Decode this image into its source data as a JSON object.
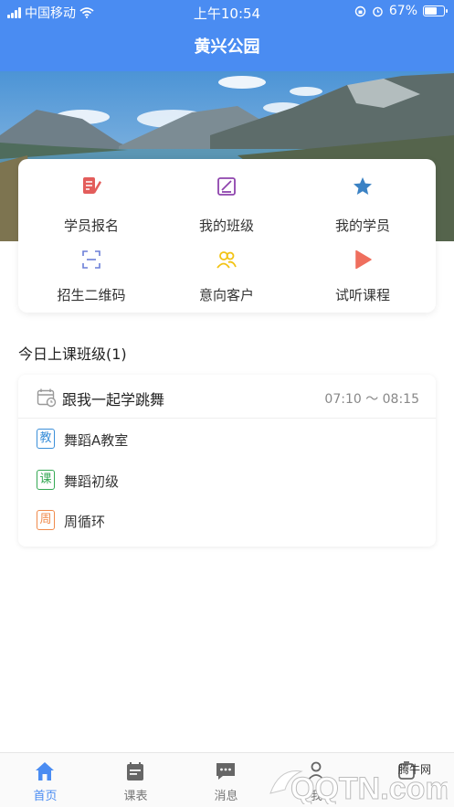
{
  "status_bar": {
    "carrier": "中国移动",
    "time": "上午10:54",
    "battery_text": "67%",
    "battery_level": 0.67
  },
  "header": {
    "title": "黄兴公园"
  },
  "menu": {
    "items": [
      {
        "label": "学员报名",
        "icon": "sign-up-icon",
        "color": "#e35d5b"
      },
      {
        "label": "我的班级",
        "icon": "class-edit-icon",
        "color": "#8e44ad"
      },
      {
        "label": "我的学员",
        "icon": "star-icon",
        "color": "#3b82c4"
      },
      {
        "label": "招生二维码",
        "icon": "qr-scan-icon",
        "color": "#6b7fd7"
      },
      {
        "label": "意向客户",
        "icon": "customers-icon",
        "color": "#f2c314"
      },
      {
        "label": "试听课程",
        "icon": "play-icon",
        "color": "#ef6f5e"
      }
    ]
  },
  "today": {
    "section_title": "今日上课班级(1)",
    "class": {
      "name": "跟我一起学跳舞",
      "time": "07:10 ～ 08:15",
      "details": [
        {
          "tag": "教",
          "value": "舞蹈A教室",
          "color": "#3b8fd9"
        },
        {
          "tag": "课",
          "value": "舞蹈初级",
          "color": "#34a853"
        },
        {
          "tag": "周",
          "value": "周循环",
          "color": "#f08a4b"
        }
      ]
    }
  },
  "tabbar": {
    "tabs": [
      {
        "label": "首页",
        "icon": "home-icon",
        "active": true
      },
      {
        "label": "课表",
        "icon": "calendar-icon",
        "active": false
      },
      {
        "label": "消息",
        "icon": "message-icon",
        "active": false
      },
      {
        "label": "我",
        "icon": "profile-icon",
        "active": false
      },
      {
        "label": "",
        "icon": "more-icon",
        "active": false
      }
    ]
  },
  "watermark": {
    "brand": "腾牛网",
    "text": "QQTN.com"
  },
  "colors": {
    "primary": "#4a8cf2"
  }
}
